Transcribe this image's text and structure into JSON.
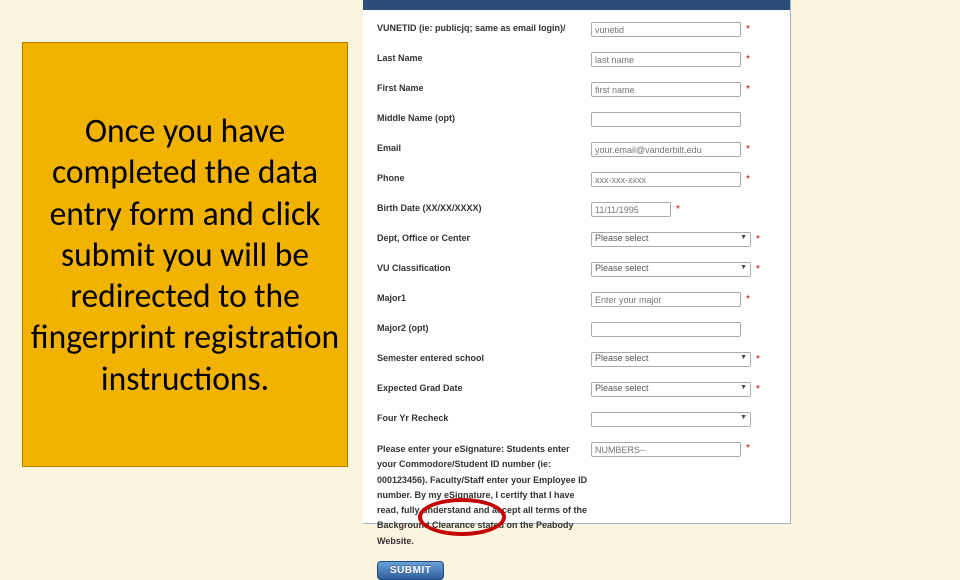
{
  "callout": {
    "text": "Once you have completed the data entry form and click submit you will be redirected to the fingerprint registration instructions."
  },
  "form": {
    "fields": {
      "vunetid": {
        "label": "VUNETID (ie: publicjq; same as email login)/",
        "placeholder": "vunetid",
        "required": true
      },
      "lastName": {
        "label": "Last Name",
        "placeholder": "last name",
        "required": true
      },
      "firstName": {
        "label": "First Name",
        "placeholder": "first name",
        "required": true
      },
      "middleName": {
        "label": "Middle Name (opt)",
        "placeholder": "",
        "required": false
      },
      "email": {
        "label": "Email",
        "placeholder": "your.email@vanderbilt.edu",
        "required": true
      },
      "phone": {
        "label": "Phone",
        "placeholder": "xxx-xxx-xxxx",
        "required": true
      },
      "birthDate": {
        "label": "Birth Date (XX/XX/XXXX)",
        "placeholder": "11/11/1995",
        "required": true
      },
      "dept": {
        "label": "Dept, Office or Center",
        "selected": "Please select",
        "required": true
      },
      "vuClass": {
        "label": "VU Classification",
        "selected": "Please select",
        "required": true
      },
      "major1": {
        "label": "Major1",
        "placeholder": "Enter your major",
        "required": true
      },
      "major2": {
        "label": "Major2 (opt)",
        "placeholder": "",
        "required": false
      },
      "semester": {
        "label": "Semester entered school",
        "selected": "Please select",
        "required": true
      },
      "gradDate": {
        "label": "Expected Grad Date",
        "selected": "Please select",
        "required": true
      },
      "fourYr": {
        "label": "Four Yr Recheck",
        "selected": "",
        "required": false
      }
    },
    "esig": {
      "text": "Please enter your eSignature: Students enter your Commodore/Student ID number (ie: 000123456). Faculty/Staff enter your Employee ID number. By my eSignature, I certify that I have read, fully understand and accept all terms of the Background Clearance stated on the Peabody Website.",
      "placeholder": "NUMBERS--",
      "required": true
    },
    "submitLabel": "SUBMIT"
  },
  "reqMark": "*"
}
